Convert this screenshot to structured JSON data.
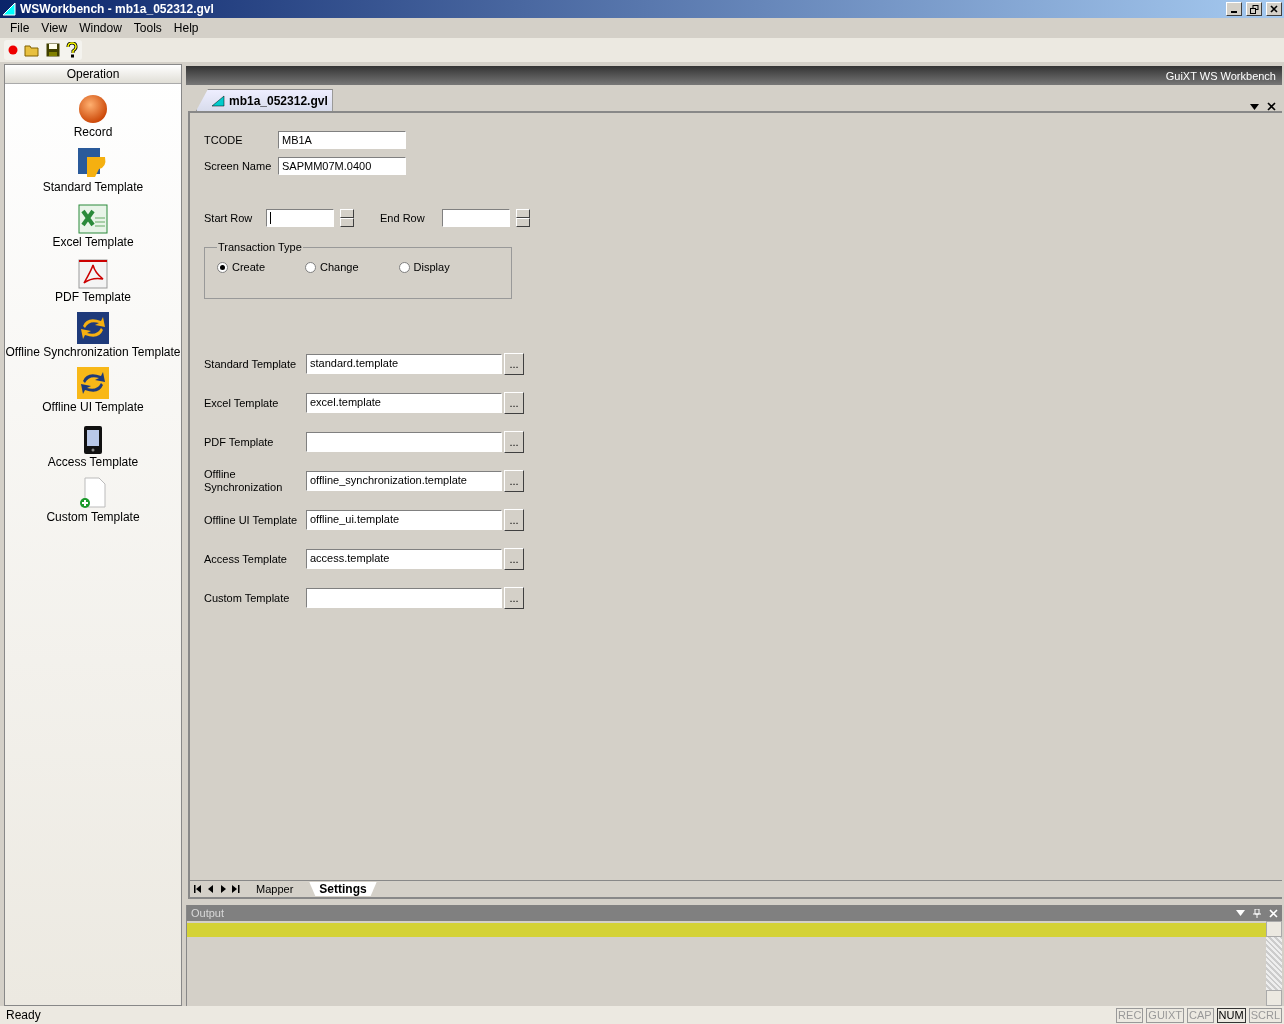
{
  "window": {
    "title": "WSWorkbench - mb1a_052312.gvl"
  },
  "menu": [
    "File",
    "View",
    "Window",
    "Tools",
    "Help"
  ],
  "sidebar": {
    "title": "Operation",
    "items": [
      {
        "kind": "record",
        "label": "Record"
      },
      {
        "kind": "standard",
        "label": "Standard Template"
      },
      {
        "kind": "excel",
        "label": "Excel Template"
      },
      {
        "kind": "pdf",
        "label": "PDF Template"
      },
      {
        "kind": "sync",
        "label": "Offline Synchronization Template"
      },
      {
        "kind": "offline",
        "label": "Offline UI Template"
      },
      {
        "kind": "access",
        "label": "Access Template"
      },
      {
        "kind": "custom",
        "label": "Custom Template"
      }
    ]
  },
  "header_title": "GuiXT WS Workbench",
  "document_tab": {
    "label": "mb1a_052312.gvl"
  },
  "settings": {
    "tcode": {
      "label": "TCODE",
      "value": "MB1A"
    },
    "screen_name": {
      "label": "Screen Name",
      "value": "SAPMM07M.0400"
    },
    "start_row": {
      "label": "Start Row"
    },
    "end_row": {
      "label": "End Row"
    },
    "transaction_type": {
      "title": "Transaction Type",
      "options": [
        {
          "label": "Create",
          "selected": true
        },
        {
          "label": "Change",
          "selected": false
        },
        {
          "label": "Display",
          "selected": false
        }
      ]
    },
    "templates": [
      {
        "label": "Standard Template",
        "value": "standard.template",
        "button": "..."
      },
      {
        "label": "Excel Template",
        "value": "excel.template",
        "button": "..."
      },
      {
        "label": "PDF Template",
        "button": "..."
      },
      {
        "label": "Offline Synchronization",
        "value": "offline_synchronization.template",
        "button": "..."
      },
      {
        "label": "Offline UI Template",
        "value": "offline_ui.template",
        "button": "..."
      },
      {
        "label": "Access Template",
        "value": "access.template",
        "button": "..."
      },
      {
        "label": "Custom Template",
        "button": "..."
      }
    ]
  },
  "bottom_tabs": [
    {
      "label": "Mapper",
      "selected": false
    },
    {
      "label": "Settings",
      "selected": true
    }
  ],
  "output": {
    "title": "Output"
  },
  "status_bar": {
    "text": "Ready",
    "indicators": [
      {
        "label": "REC",
        "on": false
      },
      {
        "label": "GUIXT",
        "on": false
      },
      {
        "label": "CAP",
        "on": false
      },
      {
        "label": "NUM",
        "on": true
      },
      {
        "label": "SCRL",
        "on": false
      }
    ]
  }
}
